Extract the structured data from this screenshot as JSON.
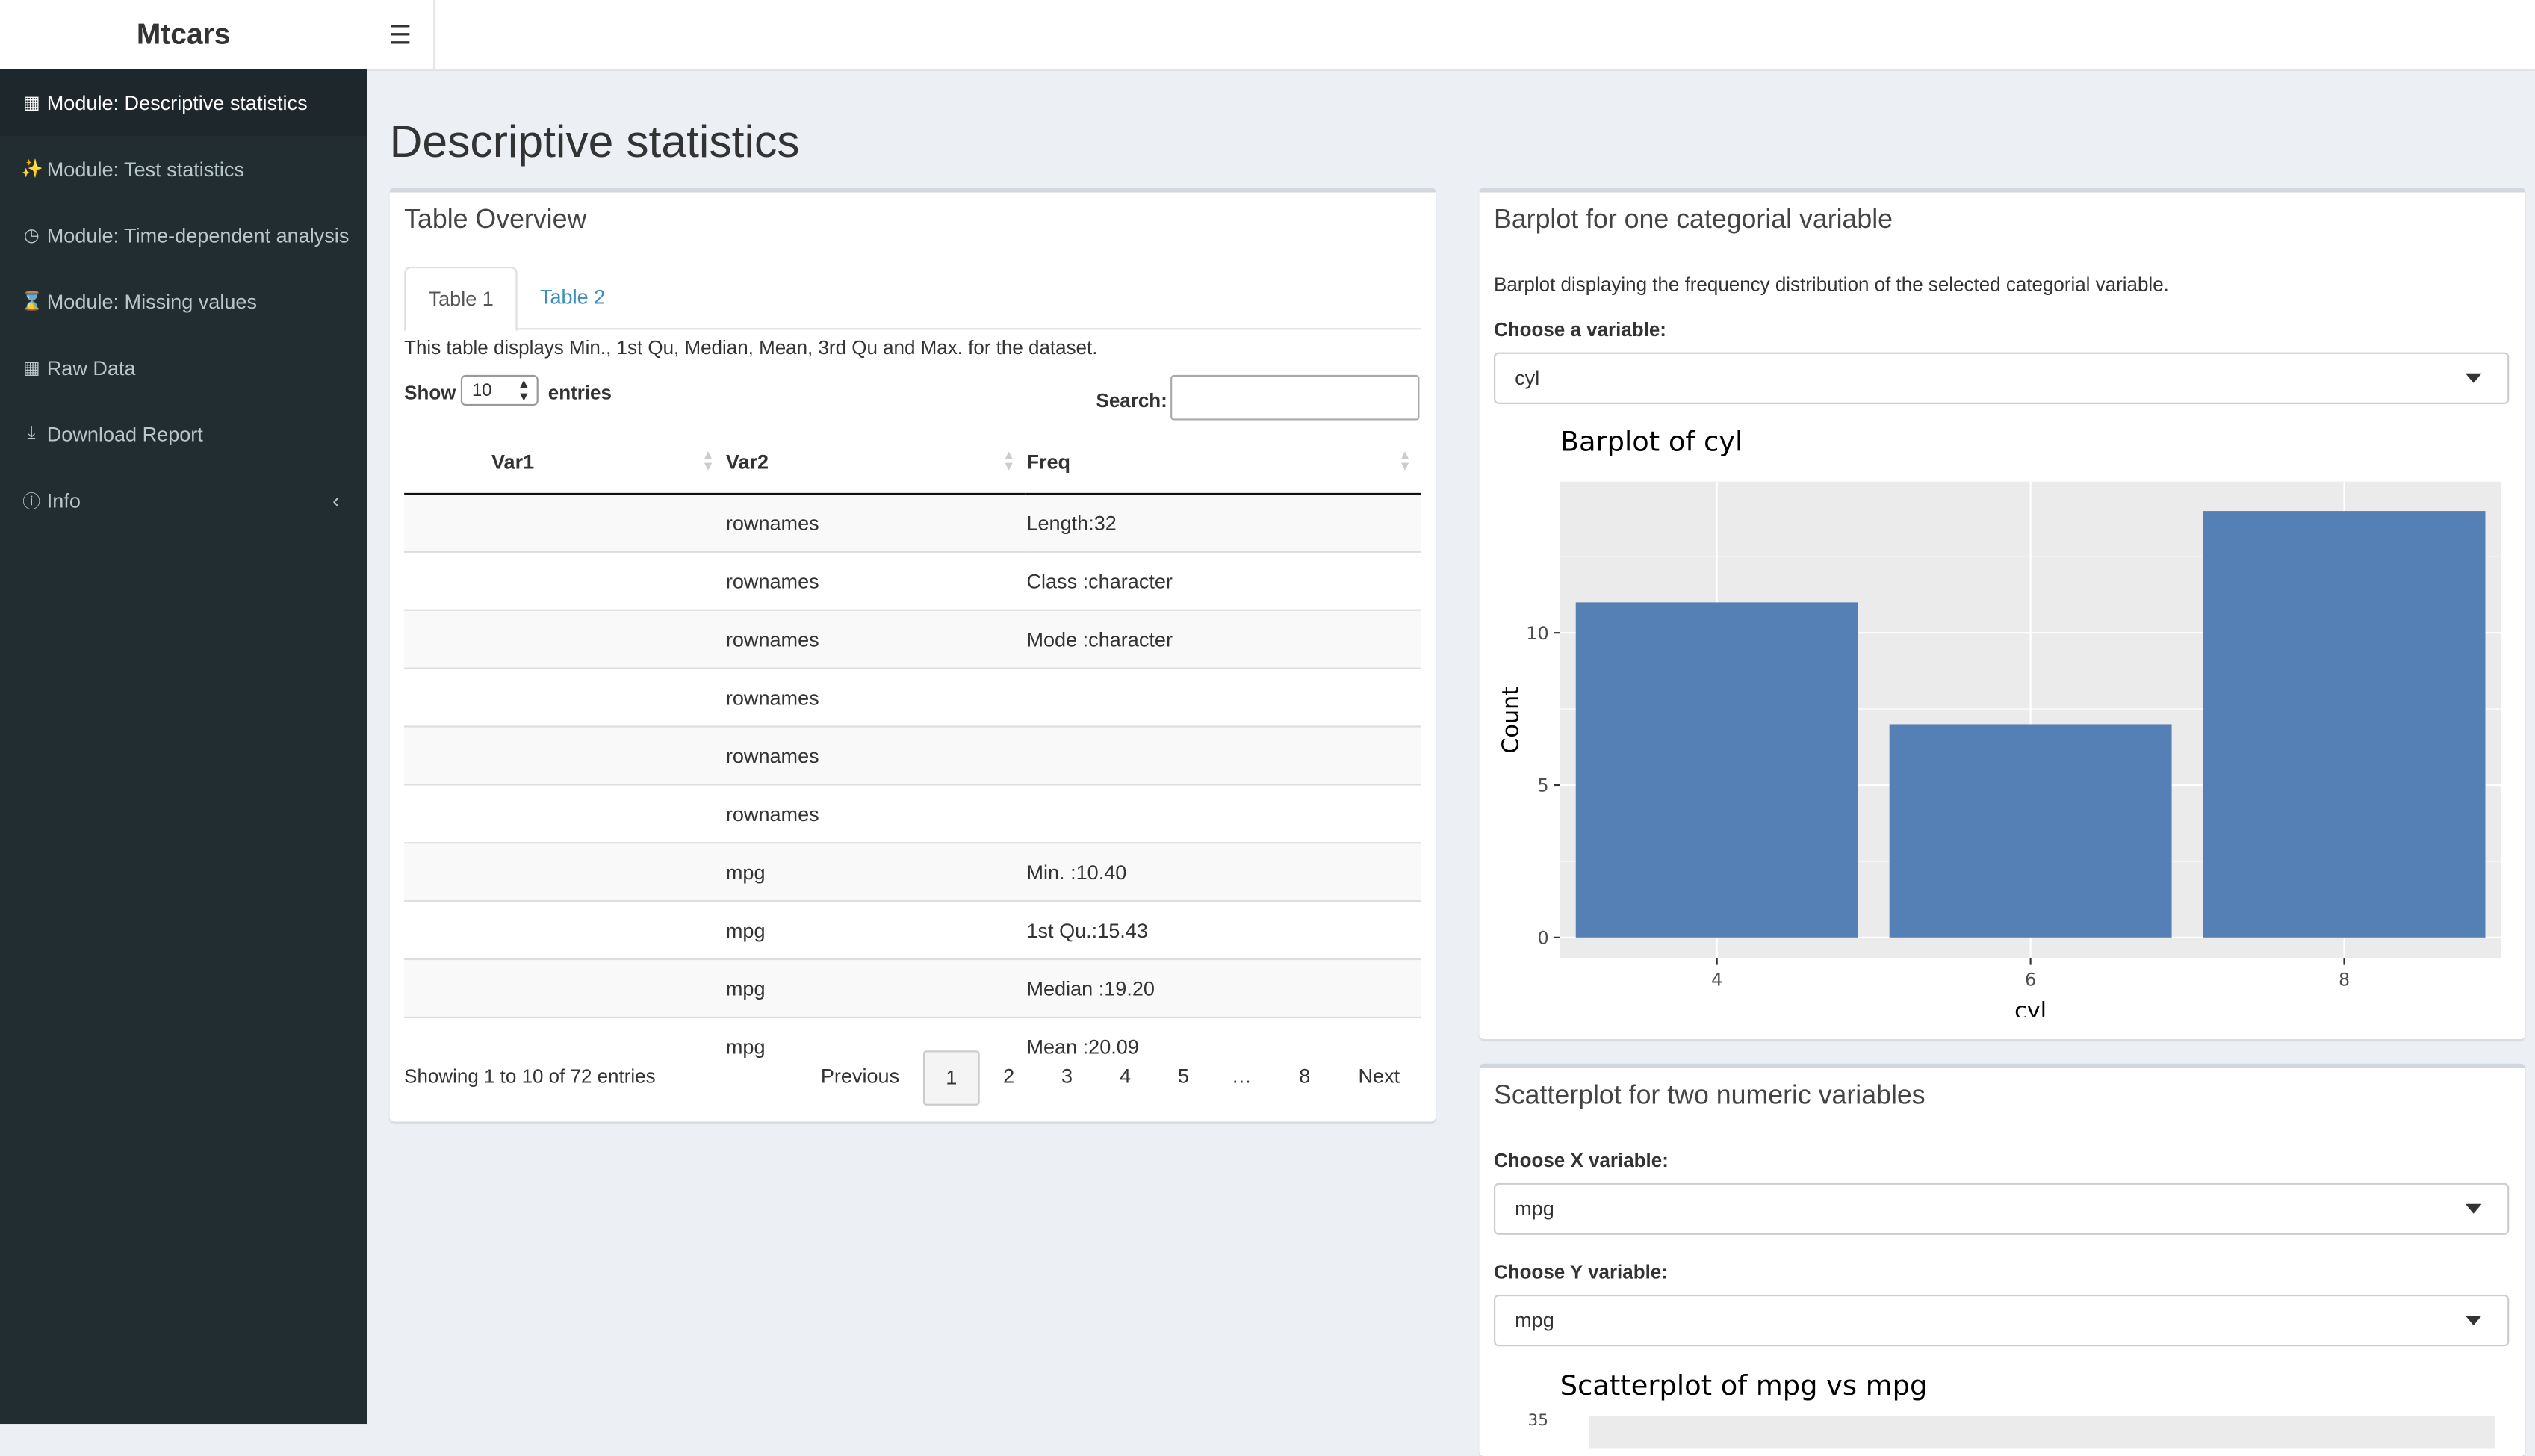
{
  "app": {
    "title": "Mtcars"
  },
  "sidebar": {
    "items": [
      {
        "label": "Module: Descriptive statistics",
        "icon": "table-icon"
      },
      {
        "label": "Module: Test statistics",
        "icon": "magic-icon"
      },
      {
        "label": "Module: Time-dependent analysis",
        "icon": "clock-icon"
      },
      {
        "label": "Module: Missing values",
        "icon": "hourglass-icon"
      },
      {
        "label": "Raw Data",
        "icon": "table-icon"
      },
      {
        "label": "Download Report",
        "icon": "download-icon"
      },
      {
        "label": "Info",
        "icon": "info-icon"
      }
    ]
  },
  "page": {
    "title": "Descriptive statistics"
  },
  "table_box": {
    "title": "Table Overview",
    "tabs": [
      "Table 1",
      "Table 2"
    ],
    "description": "This table displays Min., 1st Qu, Median, Mean, 3rd Qu and Max. for the dataset.",
    "show_label": "Show",
    "show_value": "10",
    "entries_label": "entries",
    "search_label": "Search:",
    "search_value": "",
    "columns": [
      "Var1",
      "Var2",
      "Freq"
    ],
    "rows": [
      [
        "",
        "rownames",
        "Length:32"
      ],
      [
        "",
        "rownames",
        "Class :character"
      ],
      [
        "",
        "rownames",
        "Mode :character"
      ],
      [
        "",
        "rownames",
        ""
      ],
      [
        "",
        "rownames",
        ""
      ],
      [
        "",
        "rownames",
        ""
      ],
      [
        "",
        "mpg",
        "Min. :10.40"
      ],
      [
        "",
        "mpg",
        "1st Qu.:15.43"
      ],
      [
        "",
        "mpg",
        "Median :19.20"
      ],
      [
        "",
        "mpg",
        "Mean :20.09"
      ]
    ],
    "info": "Showing 1 to 10 of 72 entries",
    "pager": {
      "previous": "Previous",
      "pages": [
        "1",
        "2",
        "3",
        "4",
        "5",
        "…",
        "8"
      ],
      "next": "Next",
      "current": "1"
    }
  },
  "bar_box": {
    "title": "Barplot for one categorial variable",
    "description": "Barplot displaying the frequency distribution of the selected categorial variable.",
    "choose_label": "Choose a variable:",
    "selected": "cyl",
    "plot_title": "Barplot of cyl"
  },
  "scatter_box": {
    "title": "Scatterplot for two numeric variables",
    "x_label": "Choose X variable:",
    "x_selected": "mpg",
    "y_label": "Choose Y variable:",
    "y_selected": "mpg",
    "plot_title": "Scatterplot of mpg vs mpg",
    "y_top_tick": "35"
  },
  "chart_data": {
    "type": "bar",
    "title": "Barplot of cyl",
    "categories": [
      "4",
      "6",
      "8"
    ],
    "values": [
      11,
      7,
      14
    ],
    "xlabel": "cyl",
    "ylabel": "Count",
    "yticks": [
      0,
      5,
      10
    ],
    "ylim": [
      0,
      14.7
    ],
    "grid": true,
    "bar_color": "#5580b5",
    "panel_color": "#ebebeb"
  },
  "colors": {
    "sidebar": "#222d32",
    "sidebar_active": "#1e282c",
    "link": "#3c8dbc",
    "background": "#ecf0f5"
  }
}
